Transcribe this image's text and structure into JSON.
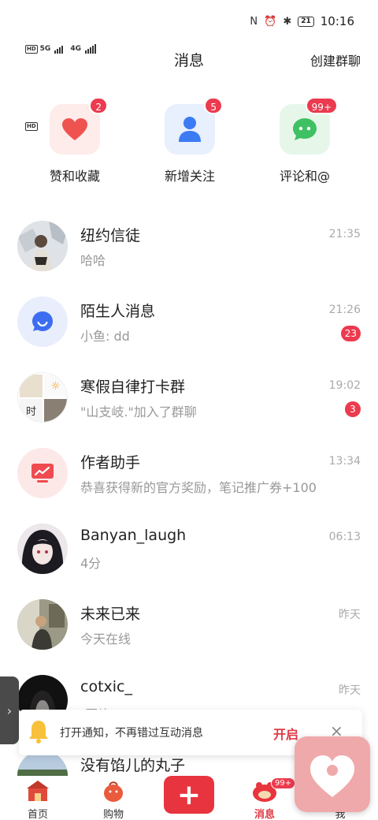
{
  "status_bar": {
    "sim1_label": "HD",
    "sim2_label": "HD",
    "net1": "5G",
    "net2": "4G",
    "battery": "21",
    "time": "10:16"
  },
  "header": {
    "title": "消息",
    "create_group": "创建群聊"
  },
  "quick_actions": [
    {
      "label": "赞和收藏",
      "badge": "2",
      "icon": "heart-icon",
      "color": "#ef5350"
    },
    {
      "label": "新增关注",
      "badge": "5",
      "icon": "person-icon",
      "color": "#3d7bf5"
    },
    {
      "label": "评论和@",
      "badge": "99+",
      "icon": "chat-bubble-icon",
      "color": "#3fc163"
    }
  ],
  "conversations": [
    {
      "name": "纽约信徒",
      "preview": "哈哈",
      "time": "21:35",
      "badge": ""
    },
    {
      "name": "陌生人消息",
      "preview": "小鱼: dd",
      "time": "21:26",
      "badge": "23"
    },
    {
      "name": "寒假自律打卡群",
      "preview": "\"山支岐.\"加入了群聊",
      "time": "19:02",
      "badge": "3",
      "avatar_text": "时"
    },
    {
      "name": "作者助手",
      "preview": "恭喜获得新的官方奖励，笔记推广券+100",
      "time": "13:34",
      "badge": ""
    },
    {
      "name": "Banyan_laugh",
      "preview": "4分",
      "time": "06:13",
      "badge": ""
    },
    {
      "name": "未来已来",
      "preview": "今天在线",
      "time": "昨天",
      "badge": ""
    },
    {
      "name": "cotxic_",
      "preview": "[图片]",
      "time": "昨天",
      "badge": ""
    },
    {
      "name": "没有馅儿的丸子",
      "preview": "",
      "time": "",
      "badge": ""
    }
  ],
  "notification_banner": {
    "text": "打开通知，不再错过互动消息",
    "action": "开启",
    "close": "×"
  },
  "bottom_nav": {
    "home": "首页",
    "shop": "购物",
    "add": "+",
    "messages": "消息",
    "messages_badge": "99+",
    "me": "我"
  },
  "colors": {
    "accent": "#e8343f",
    "badge": "#ec3a4e"
  }
}
